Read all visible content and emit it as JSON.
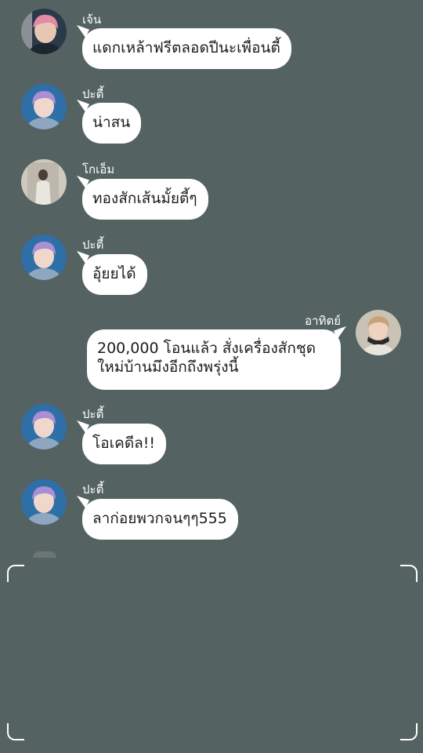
{
  "messages": [
    {
      "sender": "เจ้น",
      "text": "แดกเหล้าฟรีตลอดปีนะเพื่อนตี้",
      "side": "left",
      "avatar": "avatar-pink-hair"
    },
    {
      "sender": "ปะตี้",
      "text": "น่าสน",
      "side": "left",
      "avatar": "avatar-purple-hair"
    },
    {
      "sender": "โกเอ็ม",
      "text": "ทองสักเส้นมั้ยตี้ๆ",
      "side": "left",
      "avatar": "avatar-mirror-selfie"
    },
    {
      "sender": "ปะตี้",
      "text": "อุ้ยยได้",
      "side": "left",
      "avatar": "avatar-purple-hair"
    },
    {
      "sender": "อาทิตย์",
      "text": "200,000 โอนแล้ว สั่งเครื่องสักชุดใหม่บ้านมึงอีกถึงพรุ่งนี้",
      "side": "right",
      "avatar": "avatar-headphones"
    },
    {
      "sender": "ปะตี้",
      "text": "โอเคดีล!!",
      "side": "left",
      "avatar": "avatar-purple-hair"
    },
    {
      "sender": "ปะตี้",
      "text": "ลาก่อยพวกจนๆๆ555",
      "side": "left",
      "avatar": "avatar-purple-hair"
    }
  ],
  "colors": {
    "background": "#546361",
    "bubble": "#ffffff",
    "name": "#ffffff"
  }
}
